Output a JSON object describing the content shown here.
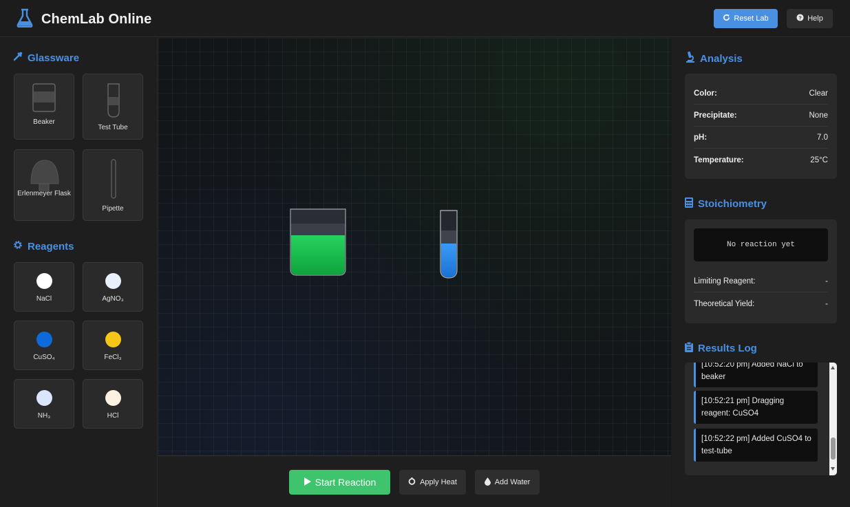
{
  "header": {
    "title": "ChemLab Online",
    "reset_label": "Reset Lab",
    "help_label": "Help"
  },
  "glassware": {
    "title": "Glassware",
    "items": [
      {
        "label": "Beaker"
      },
      {
        "label": "Test Tube"
      },
      {
        "label": "Erlenmeyer Flask"
      },
      {
        "label": "Pipette"
      }
    ]
  },
  "reagents": {
    "title": "Reagents",
    "items": [
      {
        "label": "NaCl",
        "color": "#ffffff"
      },
      {
        "label": "AgNO₃",
        "color": "#e8f0fb"
      },
      {
        "label": "CuSO₄",
        "color": "#0d6ad8"
      },
      {
        "label": "FeCl₃",
        "color": "#f5c518"
      },
      {
        "label": "NH₃",
        "color": "#d9e6fc"
      },
      {
        "label": "HCl",
        "color": "#fdf1e2"
      }
    ]
  },
  "workspace": {
    "beaker_liquid_color": "#1fb84f",
    "test_tube_liquid_color": "#2a8ef0"
  },
  "actions": {
    "start_label": "Start Reaction",
    "heat_label": "Apply Heat",
    "water_label": "Add Water"
  },
  "analysis": {
    "title": "Analysis",
    "rows": [
      {
        "key": "Color:",
        "value": "Clear"
      },
      {
        "key": "Precipitate:",
        "value": "None"
      },
      {
        "key": "pH:",
        "value": "7.0"
      },
      {
        "key": "Temperature:",
        "value": "25°C"
      }
    ]
  },
  "stoichiometry": {
    "title": "Stoichiometry",
    "display": "No reaction yet",
    "rows": [
      {
        "key": "Limiting Reagent:",
        "value": "-"
      },
      {
        "key": "Theoretical Yield:",
        "value": "-"
      }
    ]
  },
  "results": {
    "title": "Results Log",
    "entries": [
      {
        "text": "[10:52:20 pm] Added NaCl to beaker"
      },
      {
        "text": "[10:52:21 pm] Dragging reagent: CuSO4"
      },
      {
        "text": "[10:52:22 pm] Added CuSO4 to test-tube"
      }
    ]
  },
  "colors": {
    "accent": "#4a90e2",
    "start_button": "#3ec46d"
  }
}
